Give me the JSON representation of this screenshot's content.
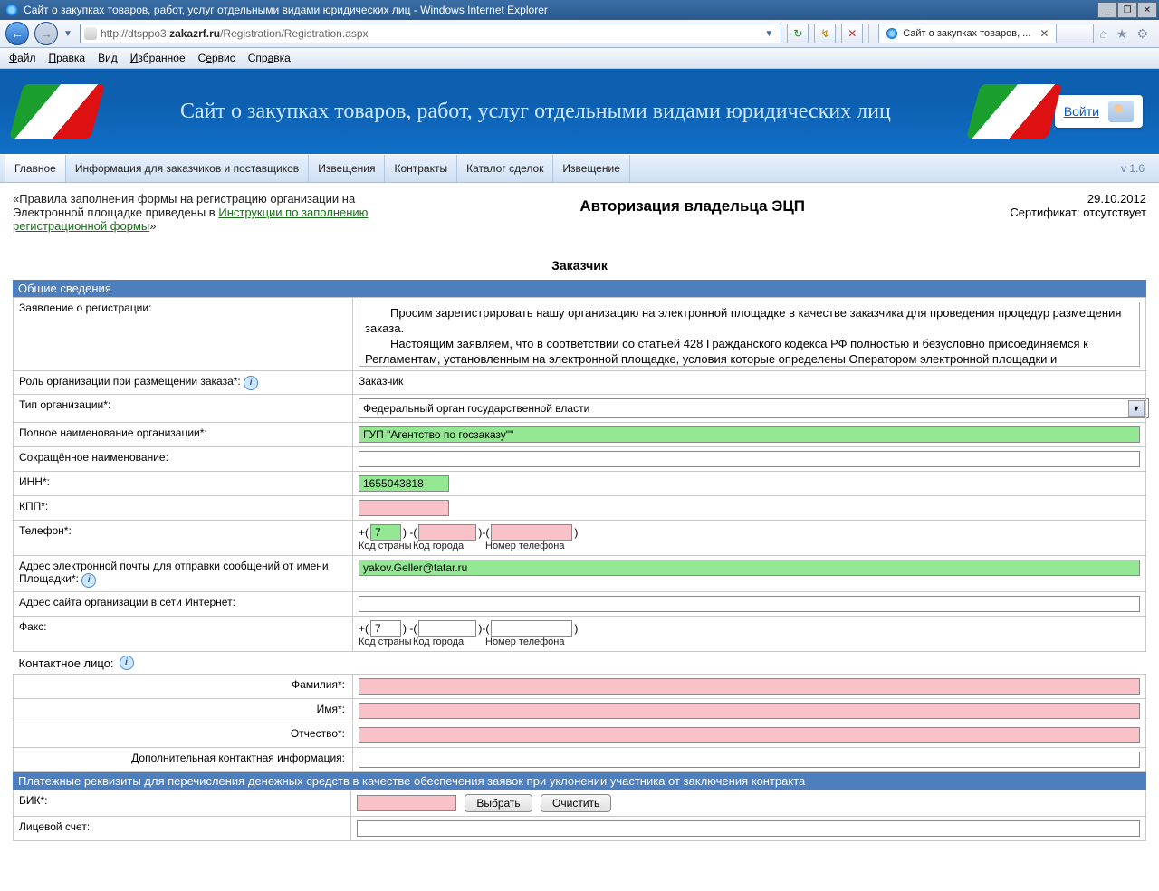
{
  "window": {
    "title": "Сайт о закупках товаров, работ, услуг отдельными видами юридических лиц - Windows Internet Explorer",
    "url": "http://dtsppo3.zakazrf.ru/Registration/Registration.aspx",
    "tab_label": "Сайт о закупках товаров, ...",
    "url_domain": "zakazrf.ru",
    "url_prefix": "http://dtsppo3.",
    "url_suffix": "/Registration/Registration.aspx"
  },
  "menubar": {
    "file": "Файл",
    "edit": "Правка",
    "view": "Вид",
    "favorites": "Избранное",
    "tools": "Сервис",
    "help": "Справка"
  },
  "banner": {
    "title": "Сайт о закупках товаров, работ, услуг отдельными видами юридических лиц",
    "login": "Войти"
  },
  "mainnav": {
    "items": [
      "Главное",
      "Информация для заказчиков и поставщиков",
      "Извещения",
      "Контракты",
      "Каталог сделок",
      "Извещение"
    ],
    "version": "v 1.6"
  },
  "toprow": {
    "note_prefix": "«Правила заполнения формы на регистрацию организации на Электронной площадке приведены в ",
    "note_link": "Инструкции по заполнению регистрационной формы",
    "note_suffix": "»",
    "title": "Авторизация владельца ЭЦП",
    "date": "29.10.2012",
    "cert": "Сертификат: отсутствует"
  },
  "subheader": "Заказчик",
  "sections": {
    "general": "Общие сведения",
    "payment": "Платежные реквизиты для перечисления денежных средств в качестве обеспечения заявок при уклонении участника от заключения контракта"
  },
  "form": {
    "registration_statement_label": "Заявление о регистрации:",
    "registration_text_p1": "Просим зарегистрировать нашу организацию на электронной площадке в качестве заказчика для проведения процедур размещения заказа.",
    "registration_text_p2": "Настоящим заявляем, что в соответствии со статьей 428 Гражданского кодекса РФ полностью и безусловно присоединяемся к Регламентам, установленным на электронной площадке, условия которые определены Оператором электронной площадки и",
    "role_label": "Роль организации при размещении заказа*:",
    "role_value": "Заказчик",
    "type_label": "Тип организации*:",
    "type_value": "Федеральный орган государственной власти",
    "fullname_label": "Полное наименование организации*:",
    "fullname_value": "ГУП \"Агентство по госзаказу\"\"",
    "shortname_label": "Сокращённое наименование:",
    "inn_label": "ИНН*:",
    "inn_value": "1655043818",
    "kpp_label": "КПП*:",
    "phone_label": "Телефон*:",
    "phone_country": "7",
    "phone_sublabels": {
      "country": "Код страны",
      "city": "Код города",
      "number": "Номер телефона"
    },
    "email_label": "Адрес электронной почты для отправки сообщений от имени Площадки*:",
    "email_value": "yakov.Geller@tatar.ru",
    "site_label": "Адрес сайта организации в сети Интернет:",
    "fax_label": "Факс:",
    "fax_country": "7",
    "contact_label": "Контактное лицо:",
    "lastname_label": "Фамилия*:",
    "firstname_label": "Имя*:",
    "patronymic_label": "Отчество*:",
    "addinfo_label": "Дополнительная контактная информация:",
    "bik_label": "БИК*:",
    "bik_select": "Выбрать",
    "bik_clear": "Очистить",
    "account_label": "Лицевой счет:"
  }
}
